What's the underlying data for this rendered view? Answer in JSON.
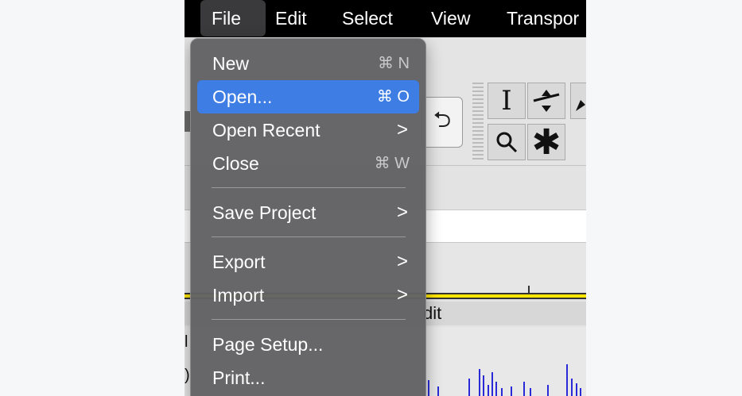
{
  "menubar": {
    "items": [
      {
        "label": "File",
        "active": true
      },
      {
        "label": "Edit"
      },
      {
        "label": "Select"
      },
      {
        "label": "View"
      },
      {
        "label": "Transpor"
      }
    ]
  },
  "file_menu": {
    "items": [
      {
        "label": "New",
        "shortcut": "⌘ N"
      },
      {
        "label": "Open...",
        "shortcut": "⌘ O",
        "highlighted": true
      },
      {
        "label": "Open Recent",
        "submenu": true
      },
      {
        "label": "Close",
        "shortcut": "⌘ W"
      },
      {
        "label": "Save Project",
        "submenu": true
      },
      {
        "label": "Export",
        "submenu": true
      },
      {
        "label": "Import",
        "submenu": true
      },
      {
        "label": "Page Setup..."
      },
      {
        "label": "Print..."
      }
    ],
    "chevron": ">",
    "highlight_color": "#3d7de4"
  },
  "background": {
    "track_header_text": "dit",
    "left_edge_1": "l",
    "left_edge_2": ")",
    "tools": {
      "select_glyph": "I",
      "zoom_glyph": "🔍",
      "multi_glyph": "✱",
      "loop_glyph": "⮌"
    }
  },
  "colors": {
    "menubar": "#000000",
    "waveform": "#2a2ad9",
    "timeline": "#ffe600"
  }
}
